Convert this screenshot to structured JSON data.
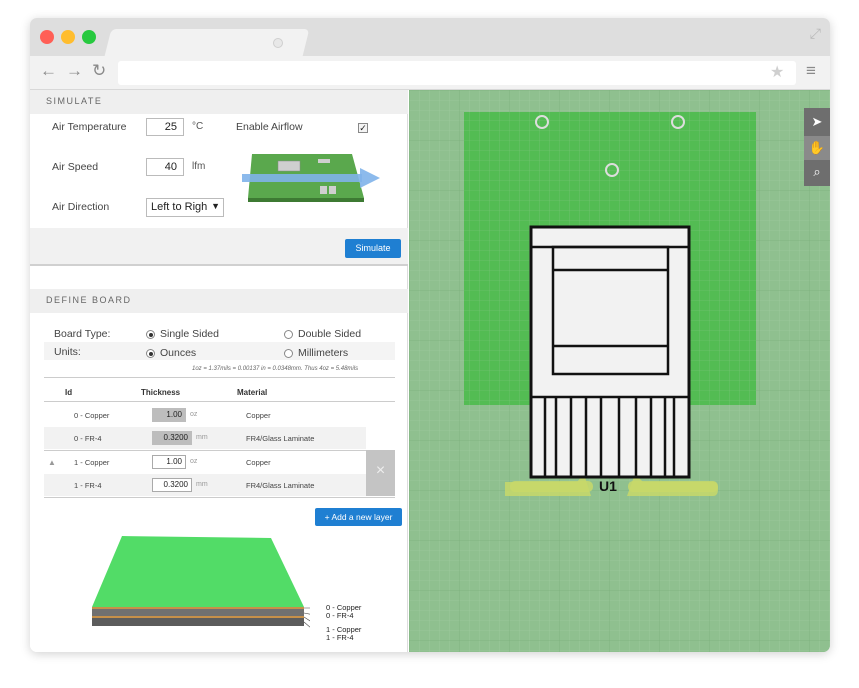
{
  "browser": {
    "url": ""
  },
  "simulate": {
    "header": "SIMULATE",
    "air_temp_label": "Air Temperature",
    "air_temp_value": "25",
    "air_temp_unit": "°C",
    "enable_airflow_label": "Enable Airflow",
    "enable_airflow_checked": true,
    "air_speed_label": "Air Speed",
    "air_speed_value": "40",
    "air_speed_unit": "lfm",
    "air_direction_label": "Air Direction",
    "air_direction_value": "Left to Righ",
    "simulate_button": "Simulate"
  },
  "define_board": {
    "header": "DEFINE BOARD",
    "board_type_label": "Board Type:",
    "board_type_options": [
      "Single Sided",
      "Double Sided"
    ],
    "board_type_selected": "Single Sided",
    "units_label": "Units:",
    "units_options": [
      "Ounces",
      "Millimeters"
    ],
    "units_selected": "Ounces",
    "conversion_note": "1oz = 1.37mils = 0.00137 in = 0.0348mm. Thus 4oz = 5.48mils",
    "table_headers": {
      "id": "Id",
      "thickness": "Thickness",
      "material": "Material"
    },
    "layers": [
      {
        "id": "0 - Copper",
        "thickness": "1.00",
        "unit": "oz",
        "material": "Copper",
        "editable": false
      },
      {
        "id": "0 - FR-4",
        "thickness": "0.3200",
        "unit": "mm",
        "material": "FR4/Glass Laminate",
        "editable": false
      },
      {
        "id": "1 - Copper",
        "thickness": "1.00",
        "unit": "oz",
        "material": "Copper",
        "editable": true
      },
      {
        "id": "1 - FR-4",
        "thickness": "0.3200",
        "unit": "mm",
        "material": "FR4/Glass Laminate",
        "editable": true
      }
    ],
    "delete_icon": "×",
    "add_layer_button": "+ Add a new layer",
    "stack_labels": [
      "0 - Copper",
      "0 - FR-4",
      "1 - Copper",
      "1 - FR-4"
    ]
  },
  "canvas": {
    "component_label": "U1",
    "board_color": "#4cbb4c",
    "background_color": "#8fc08f",
    "pad_color": "#c8d86a",
    "tools": [
      "pointer-icon",
      "hand-icon",
      "zoom-icon"
    ]
  }
}
